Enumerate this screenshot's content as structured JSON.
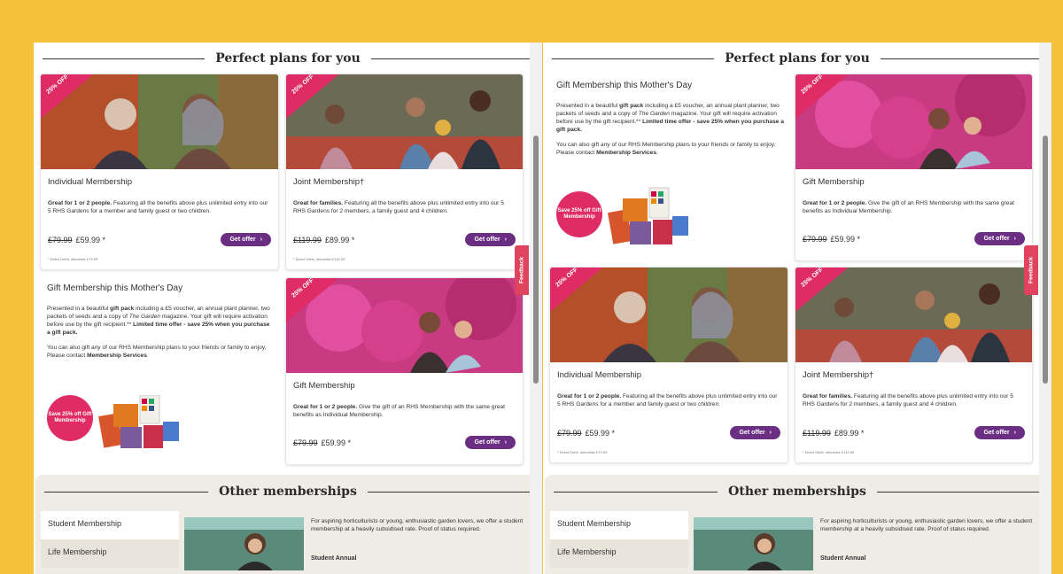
{
  "section_title": "Perfect plans for you",
  "other_title": "Other memberships",
  "badge": "25% OFF",
  "cta": "Get offer",
  "feedback": "Feedback",
  "cards": {
    "individual": {
      "name": "Individual Membership",
      "desc_bold": "Great for 1 or 2 people.",
      "desc": " Featuring all the benefits above plus unlimited entry into our 5 RHS Gardens for a member and family guest or two children.",
      "old_price": "£79.99",
      "new_price": "£59.99 *",
      "fine": "* Direct Debit, otherwise £79.99"
    },
    "joint": {
      "name": "Joint Membership†",
      "desc_bold": "Great for families.",
      "desc": " Featuring all the benefits above plus unlimited entry into our 5 RHS Gardens for 2 members, a family guest and 4 children.",
      "old_price": "£119.99",
      "new_price": "£89.99 *",
      "fine": "* Direct Debit, otherwise £119.99"
    },
    "gift": {
      "name": "Gift Membership",
      "desc_bold": "Great for 1 or 2 people.",
      "desc": " Give the gift of an RHS Membership with the same great benefits as Individual Membership.",
      "old_price": "£79.99",
      "new_price": "£59.99 *"
    }
  },
  "gift_block": {
    "title": "Gift Membership this Mother's Day",
    "p1_a": "Presented in a beautiful ",
    "p1_b": "gift pack",
    "p1_c": " including a £5 voucher, an annual plant planner, two packets of seeds and a copy of ",
    "p1_d": "The Garden",
    "p1_e": " magazine. Your gift will require activation before use by the gift recipient.** ",
    "p1_f": "Limited time offer - save 25% when you purchase a gift pack.",
    "p2_a": "You can also gift any of our RHS Membership plans to your friends or family to enjoy. Please contact ",
    "p2_b": "Membership Services",
    "p2_c": ".",
    "circle": "Save 25% off Gift Membership"
  },
  "other": {
    "menu": [
      "Student Membership",
      "Life Membership"
    ],
    "text": "For aspiring horticulturists or young, enthusiastic garden lovers, we offer a student membership at a heavily subsidised rate. Proof of status required.",
    "sub": "Student Annual"
  },
  "colors": {
    "background": "#F5C03A",
    "accent": "#E02C66",
    "button": "#6A2F83"
  }
}
